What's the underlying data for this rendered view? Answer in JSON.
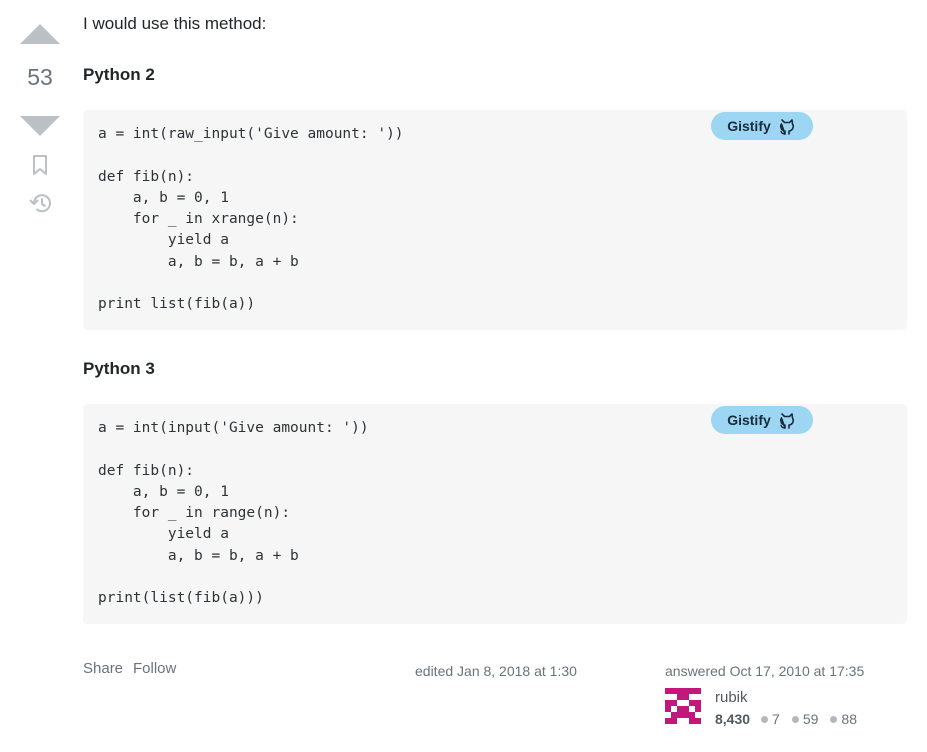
{
  "vote": {
    "score": "53"
  },
  "answer": {
    "intro": "I would use this method:",
    "sections": [
      {
        "heading": "Python 2",
        "gistify_label": "Gistify",
        "code": "a = int(raw_input('Give amount: '))\n\ndef fib(n):\n    a, b = 0, 1\n    for _ in xrange(n):\n        yield a\n        a, b = b, a + b\n\nprint list(fib(a))"
      },
      {
        "heading": "Python 3",
        "gistify_label": "Gistify",
        "code": "a = int(input('Give amount: '))\n\ndef fib(n):\n    a, b = 0, 1\n    for _ in range(n):\n        yield a\n        a, b = b, a + b\n\nprint(list(fib(a)))"
      }
    ]
  },
  "footer": {
    "share": "Share",
    "follow": "Follow",
    "edited": "edited Jan 8, 2018 at 1:30",
    "answered": "answered Oct 17, 2010 at 17:35",
    "user": {
      "name": "rubik",
      "reputation": "8,430",
      "gold": "7",
      "silver": "59",
      "bronze": "88"
    }
  },
  "colors": {
    "gistify_bg": "#9cd6f2",
    "avatar": "#c2187b",
    "code_bg": "#f6f6f6",
    "silver_badge": "#b4b8bc",
    "bronze_badge": "#d1a684"
  }
}
